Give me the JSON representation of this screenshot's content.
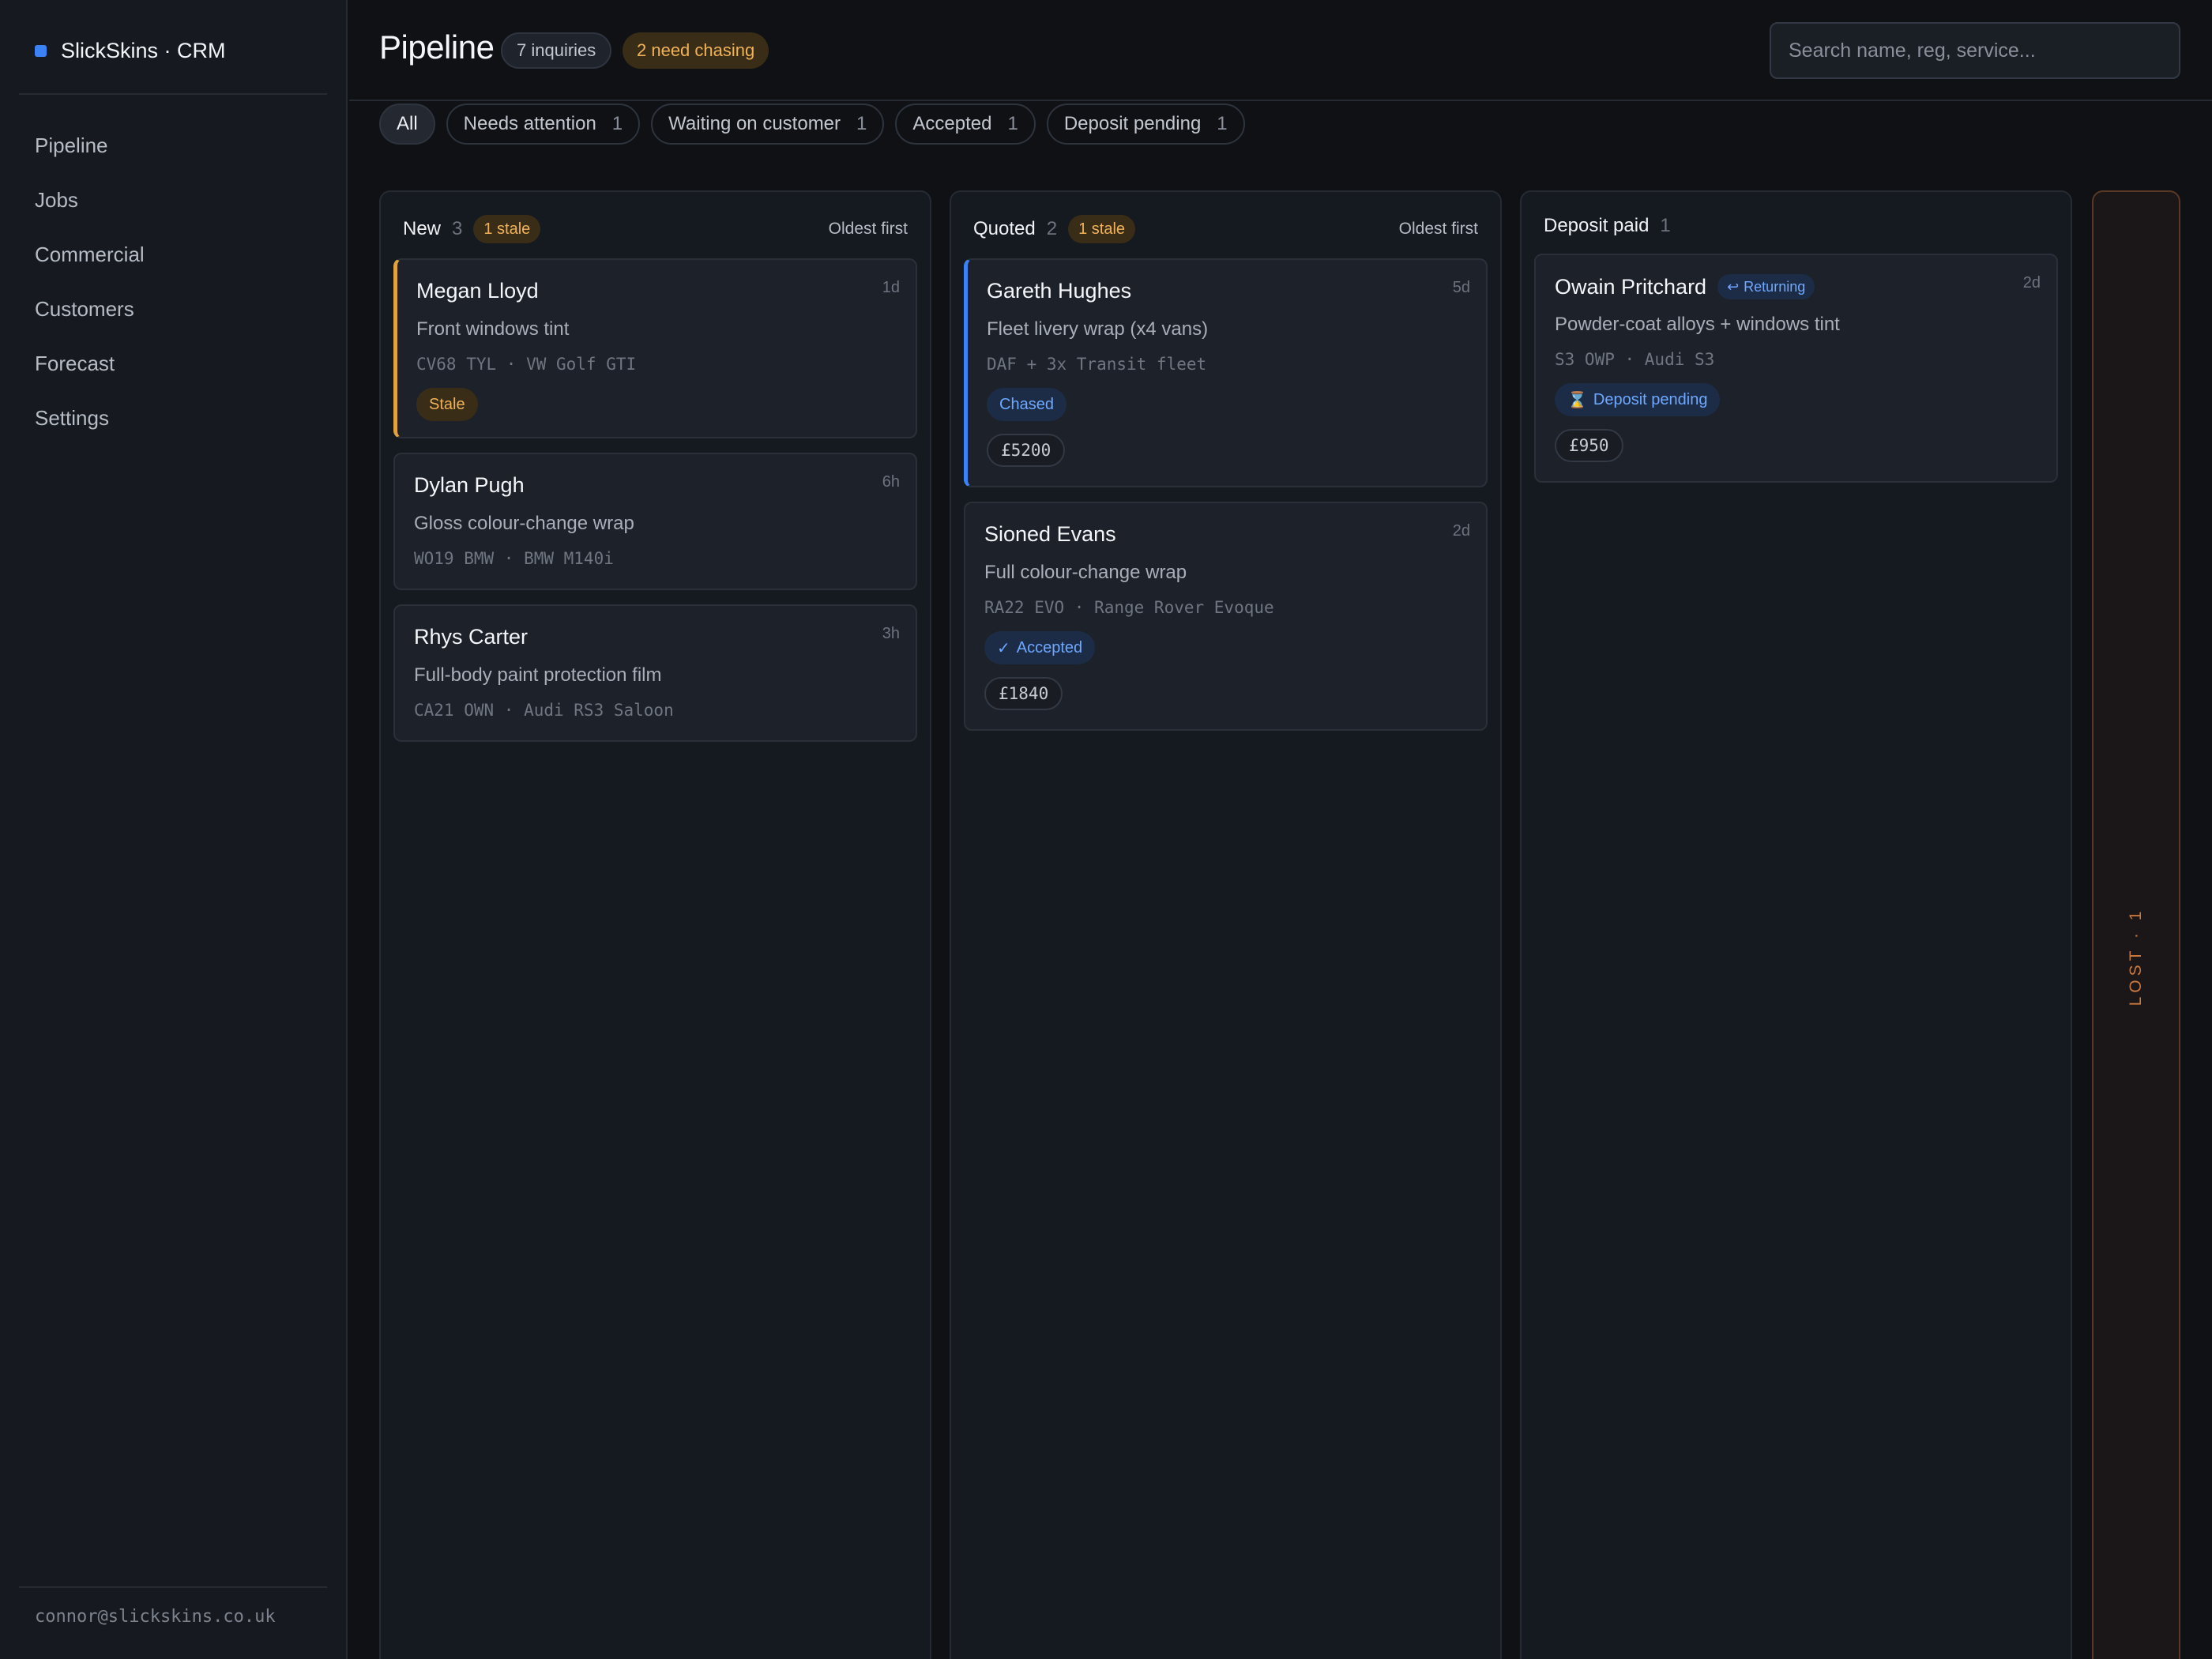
{
  "brand": {
    "name": "SlickSkins · CRM",
    "accent": "#3b82f6"
  },
  "sidebar": {
    "items": [
      {
        "label": "Pipeline"
      },
      {
        "label": "Jobs"
      },
      {
        "label": "Commercial"
      },
      {
        "label": "Customers"
      },
      {
        "label": "Forecast"
      },
      {
        "label": "Settings"
      }
    ],
    "user_email": "connor@slickskins.co.uk"
  },
  "header": {
    "title": "Pipeline",
    "inquiries_badge": "7 inquiries",
    "chasing_badge": "2 need chasing",
    "search_placeholder": "Search name, reg, service..."
  },
  "filters": [
    {
      "label": "All",
      "count": "",
      "active": true
    },
    {
      "label": "Needs attention",
      "count": "1"
    },
    {
      "label": "Waiting on customer",
      "count": "1"
    },
    {
      "label": "Accepted",
      "count": "1"
    },
    {
      "label": "Deposit pending",
      "count": "1"
    }
  ],
  "columns": {
    "new": {
      "title": "New",
      "count": "3",
      "stale": "1 stale",
      "sort": "Oldest first",
      "cards": [
        {
          "name": "Megan Lloyd",
          "age": "1d",
          "service": "Front windows tint",
          "vehicle": "CV68 TYL · VW Golf GTI",
          "tag": "Stale"
        },
        {
          "name": "Dylan Pugh",
          "age": "6h",
          "service": "Gloss colour-change wrap",
          "vehicle": "WO19 BMW · BMW M140i"
        },
        {
          "name": "Rhys Carter",
          "age": "3h",
          "service": "Full-body paint protection film",
          "vehicle": "CA21 OWN · Audi RS3 Saloon"
        }
      ]
    },
    "quoted": {
      "title": "Quoted",
      "count": "2",
      "stale": "1 stale",
      "sort": "Oldest first",
      "cards": [
        {
          "name": "Gareth Hughes",
          "age": "5d",
          "service": "Fleet livery wrap (x4 vans)",
          "vehicle": "DAF + 3x Transit fleet",
          "tag": "Chased",
          "price": "£5200"
        },
        {
          "name": "Sioned Evans",
          "age": "2d",
          "service": "Full colour-change wrap",
          "vehicle": "RA22 EVO · Range Rover Evoque",
          "tag": "Accepted",
          "tag_icon": "✓",
          "price": "£1840"
        }
      ]
    },
    "deposit": {
      "title": "Deposit paid",
      "count": "1",
      "cards": [
        {
          "name": "Owain Pritchard",
          "badge": "Returning",
          "badge_icon": "↩",
          "age": "2d",
          "service": "Powder-coat alloys + windows tint",
          "vehicle": "S3 OWP · Audi S3",
          "tag": "Deposit pending",
          "tag_icon": "⌛",
          "price": "£950"
        }
      ]
    },
    "lost": {
      "label": "LOST · 1"
    }
  }
}
